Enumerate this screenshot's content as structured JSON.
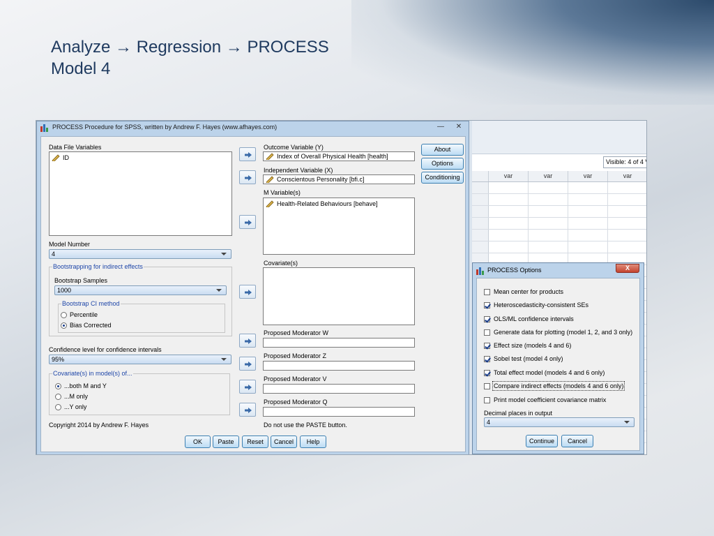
{
  "slide": {
    "title_line1": "Analyze → Regression → PROCESS",
    "title_line2": "Model 4"
  },
  "sheet": {
    "visible_text": "Visible: 4 of 4 V",
    "columns": [
      "var",
      "var",
      "var",
      "var"
    ]
  },
  "main_dialog": {
    "title": "PROCESS Procedure for SPSS, written by Andrew F. Hayes (www.afhayes.com)",
    "data_file_variables_label": "Data File Variables",
    "data_file_variables": [
      "ID"
    ],
    "model_number_label": "Model Number",
    "model_number": "4",
    "bootstrapping_group": "Bootstrapping for indirect effects",
    "bootstrap_samples_label": "Bootstrap Samples",
    "bootstrap_samples": "1000",
    "ci_method_group": "Bootstrap CI method",
    "ci_methods": [
      {
        "label": "Percentile",
        "selected": false
      },
      {
        "label": "Bias Corrected",
        "selected": true
      }
    ],
    "confidence_label": "Confidence level for confidence intervals",
    "confidence_value": "95%",
    "covariates_group": "Covariate(s) in model(s) of...",
    "covariate_options": [
      {
        "label": "...both M and Y",
        "selected": true
      },
      {
        "label": "...M only",
        "selected": false
      },
      {
        "label": "...Y only",
        "selected": false
      }
    ],
    "copyright": "Copyright 2014 by Andrew F. Hayes",
    "outcome_label": "Outcome Variable (Y)",
    "outcome_value": "Index of Overall Physical Health [health]",
    "independent_label": "Independent Variable (X)",
    "independent_value": "Conscientous Personality [bfi.c]",
    "m_label": "M Variable(s)",
    "m_values": [
      "Health-Related Behaviours [behave]"
    ],
    "covariates_label": "Covariate(s)",
    "moderator_w_label": "Proposed Moderator W",
    "moderator_z_label": "Proposed Moderator Z",
    "moderator_v_label": "Proposed Moderator V",
    "moderator_q_label": "Proposed Moderator Q",
    "paste_note": "Do not use the PASTE button.",
    "side_buttons": {
      "about": "About",
      "options": "Options",
      "conditioning": "Conditioning"
    },
    "buttons": {
      "ok": "OK",
      "paste": "Paste",
      "reset": "Reset",
      "cancel": "Cancel",
      "help": "Help"
    }
  },
  "options_dialog": {
    "title": "PROCESS Options",
    "close": "X",
    "options": [
      {
        "label": "Mean center for products",
        "checked": false
      },
      {
        "label": "Heteroscedasticity-consistent SEs",
        "checked": true
      },
      {
        "label": "OLS/ML confidence intervals",
        "checked": true
      },
      {
        "label": "Generate data for plotting (model 1, 2, and 3 only)",
        "checked": false
      },
      {
        "label": "Effect size (models 4 and 6)",
        "checked": true
      },
      {
        "label": "Sobel test (model 4 only)",
        "checked": true
      },
      {
        "label": "Total effect model (models 4 and 6 only)",
        "checked": true
      },
      {
        "label": "Compare indirect effects (models 4 and 6 only)",
        "checked": false
      },
      {
        "label": "Print model coefficient covariance matrix",
        "checked": false
      }
    ],
    "decimal_label": "Decimal places in output",
    "decimal_value": "4",
    "buttons": {
      "continue": "Continue",
      "cancel": "Cancel"
    }
  }
}
